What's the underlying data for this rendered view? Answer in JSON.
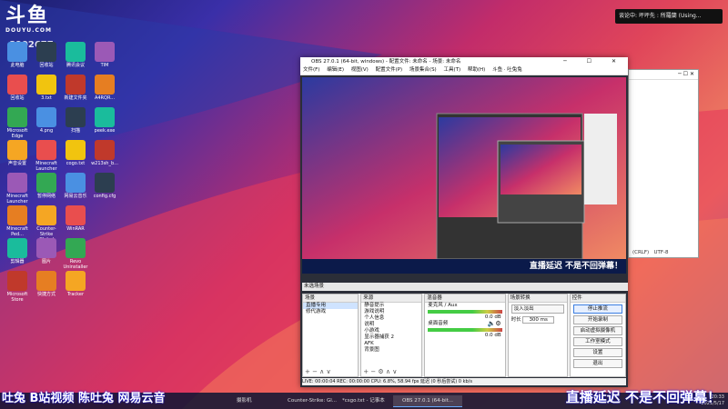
{
  "brand": {
    "logo_big": "斗鱼",
    "logo_small": "DOUYU.COM",
    "room_id": "8902677"
  },
  "notification": "谈论中: 坪坪先 : 所羅蘭 (Using...",
  "desktop_icons": [
    "此电脑",
    "回收站",
    "Microsoft Edge",
    "声音设置",
    "Minecraft Launcher",
    "Minecraft Ped...",
    "剪辑器",
    "Microsoft Store",
    "回收站",
    "3.txt",
    "4.png",
    "Minecraft Launcher",
    "暂停网络",
    "Counter-Strike Global",
    "图片",
    "快捷方式",
    "腾讯会议",
    "新建文件夹",
    "扫描",
    "cogo.txt",
    "网易云音乐",
    "WinRAR",
    "Revo Uninstaller",
    "Tracker",
    "TIM",
    "A4RQR...",
    "peek.exe",
    "w213sh_b...",
    "config.cfg"
  ],
  "obs": {
    "title": "OBS 27.0.1 (64-bit, windows) - 配置文件: 未命名 - 场景: 未命名",
    "controls": "─ ☐ ✕",
    "menu": [
      "文件(F)",
      "编辑(E)",
      "视图(V)",
      "配置文件(P)",
      "场景集合(S)",
      "工具(T)",
      "帮助(H)",
      "斗鱼 · 吐兔兔"
    ],
    "preview_banner": "直播延迟 不是不回弹幕！",
    "scene_label": "未选场景",
    "scenes": {
      "header": "场景",
      "items": [
        "直播专用",
        "修代游戏"
      ]
    },
    "sources": {
      "header": "来源",
      "items": [
        "静音提示",
        "游戏说明",
        "个人信息",
        "说明",
        "小游戏",
        "显示器捕获 2",
        "AFK",
        "背景图"
      ]
    },
    "mixer": {
      "header": "混音器",
      "tracks": [
        {
          "name": "麦克风 / Aux",
          "db": "0.0 dB"
        },
        {
          "name": "桌面音频",
          "db": "0.0 dB"
        }
      ]
    },
    "transitions": {
      "header": "场景转换",
      "type": "淡入淡出",
      "duration_label": "时长",
      "duration": "300 ms"
    },
    "controls_dock": {
      "header": "控件",
      "buttons": [
        "停止推流",
        "开始录制",
        "启动虚拟摄像机",
        "工作室模式",
        "设置",
        "退出"
      ]
    },
    "status": "LIVE: 00:00:04   REC: 00:00:00   CPU: 6.8%, 58.94 fps   延迟 (0 秒后尝试) 0 kb/s"
  },
  "notepad": {
    "encoding": "UTF-8",
    "line_ending": "(CRLF)"
  },
  "overlay": {
    "left": "吐兔  B站视频  陈吐兔 网易云音",
    "right": "直播延迟 不是不回弹幕！"
  },
  "taskbar": {
    "items": [
      "摄影机",
      "Counter-Strike: Gl...",
      "*csgo.txt - 记事本",
      "OBS 27.0.1 (64-bit..."
    ],
    "time": "20:33",
    "date": "2021/5/17"
  }
}
